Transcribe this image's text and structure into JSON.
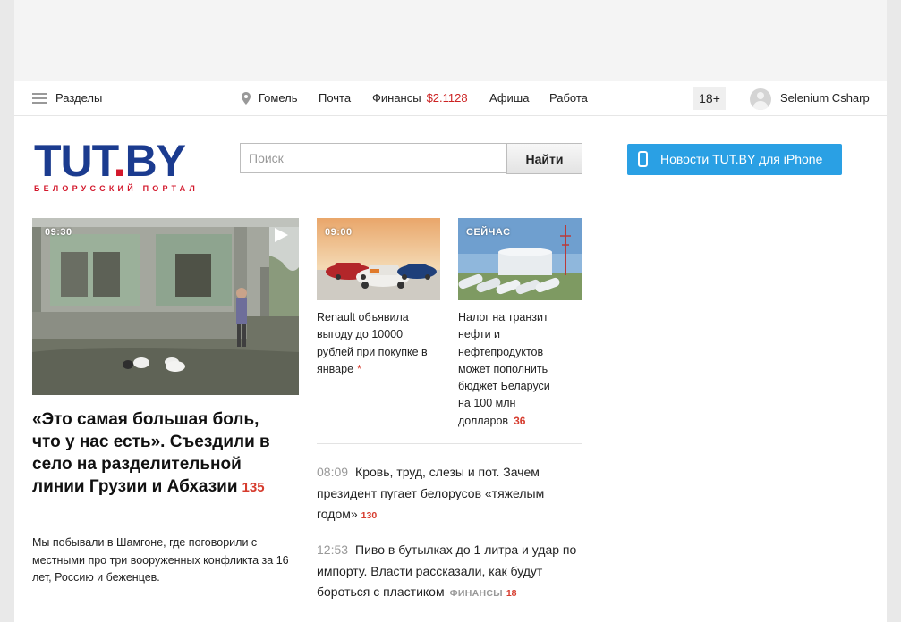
{
  "header": {
    "sections_label": "Разделы",
    "city": "Гомель",
    "mail": "Почта",
    "finance_label": "Финансы",
    "finance_rate": "$2.1128",
    "afisha": "Афиша",
    "work": "Работа",
    "age_badge": "18+",
    "user_name": "Selenium Csharp"
  },
  "logo": {
    "part1": "TUT",
    "dot": ".",
    "part2": "BY",
    "subtitle": "БЕЛОРУССКИЙ ПОРТАЛ"
  },
  "search": {
    "placeholder": "Поиск",
    "button": "Найти"
  },
  "promo": {
    "iphone": "Новости TUT.BY для iPhone"
  },
  "main_story": {
    "time": "09:30",
    "title": "«Это самая большая боль, что у нас есть». Съездили в село на разделительной линии Грузии и Абхазии",
    "comments": "135",
    "lead": "Мы побывали в Шамгоне, где поговорили с местными про три вооруженных конфликта за 16 лет, Россию и беженцев."
  },
  "side_stories": [
    {
      "time": "09:00",
      "title": "Renault объявила выгоду до 10000 рублей при покупке в январе",
      "marker": "*"
    },
    {
      "time": "СЕЙЧАС",
      "title": "Налог на транзит нефти и нефтепродуктов может пополнить бюджет Беларуси на 100 млн долларов",
      "comments": "36"
    }
  ],
  "news_list": [
    {
      "time": "08:09",
      "title": "Кровь, труд, слезы и пот. Зачем президент пугает белорусов «тяжелым годом»",
      "comments": "130"
    },
    {
      "time": "12:53",
      "title": "Пиво в бутылках до 1 литра и удар по импорту. Власти рассказали, как будут бороться с пластиком",
      "category": "ФИНАНСЫ",
      "comments": "18"
    }
  ],
  "colors": {
    "logo_blue": "#1b3b8f",
    "logo_red": "#d3182c",
    "iphone_button": "#2aa0e4",
    "comment_red": "#d63c2e"
  }
}
